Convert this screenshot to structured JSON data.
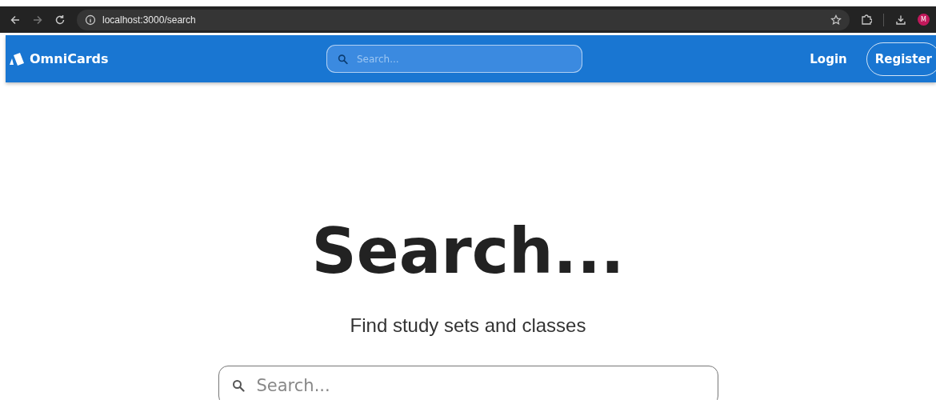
{
  "browser": {
    "url": "localhost:3000/search",
    "profile_initial": "M"
  },
  "navbar": {
    "brand": "OmniCards",
    "search": {
      "placeholder": "Search..."
    },
    "login": "Login",
    "register": "Register"
  },
  "hero": {
    "title": "Search...",
    "subtitle": "Find study sets and classes",
    "search": {
      "placeholder": "Search..."
    }
  }
}
